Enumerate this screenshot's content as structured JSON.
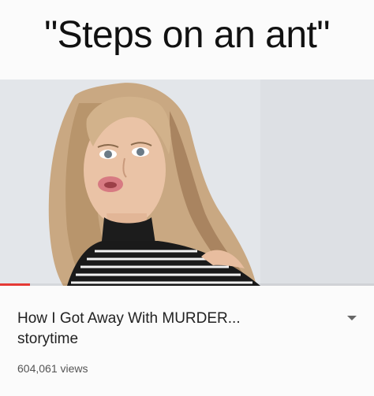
{
  "meme": {
    "caption": "\"Steps on an ant\""
  },
  "video": {
    "title_line1": "How I Got Away With MURDER...",
    "title_line2": "storytime",
    "views": "604,061 views",
    "watched_fraction": 0.08,
    "menu_icon": "chevron-down-icon"
  },
  "colors": {
    "progress": "#e53935",
    "title_text": "#222222",
    "views_text": "#555555"
  }
}
